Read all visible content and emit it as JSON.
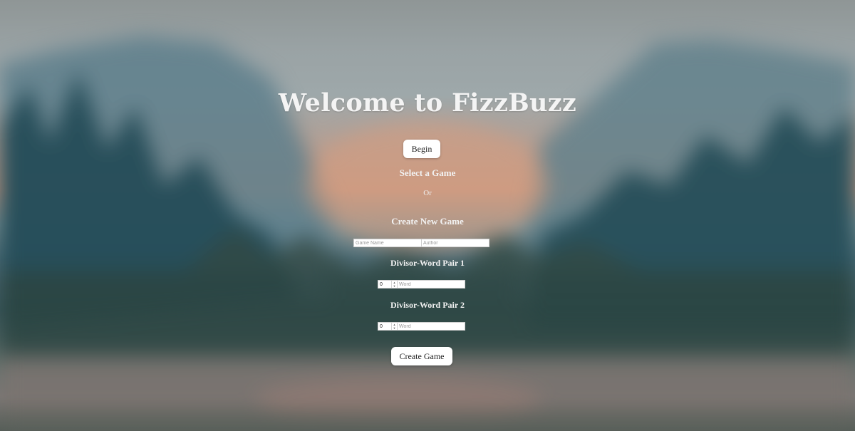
{
  "page": {
    "title": "Welcome to FizzBuzz"
  },
  "begin_button": {
    "label": "Begin"
  },
  "select_game": {
    "heading": "Select a Game",
    "or_text": "Or"
  },
  "create_game": {
    "heading": "Create New Game",
    "game_name": {
      "placeholder": "Game Name",
      "value": ""
    },
    "author": {
      "placeholder": "Author",
      "value": ""
    },
    "pairs": [
      {
        "heading": "Divisor-Word Pair 1",
        "divisor": "0",
        "word_placeholder": "Word",
        "word_value": ""
      },
      {
        "heading": "Divisor-Word Pair 2",
        "divisor": "0",
        "word_placeholder": "Word",
        "word_value": ""
      }
    ],
    "submit_label": "Create Game"
  },
  "colors": {
    "text": "#ffffff",
    "button_bg": "#ffffff",
    "button_text": "#222222",
    "sky_top": "#9aa3a5",
    "sunset": "#c69a84",
    "forest": "#3e5a60"
  },
  "icons": {
    "spinner": "number-spinner-icon"
  }
}
